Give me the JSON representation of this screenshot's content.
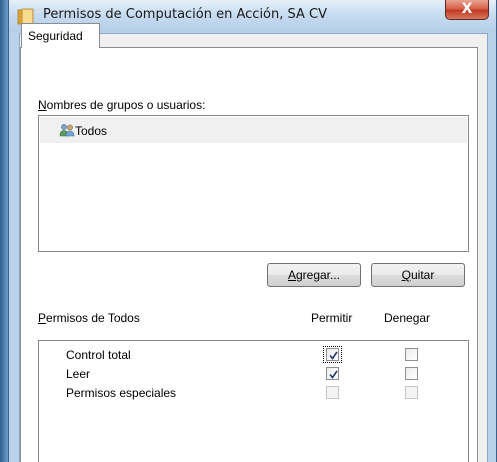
{
  "window": {
    "title": "Permisos de Computación en Acción, SA CV",
    "close_glyph": "X",
    "title_icon": "folder-icon"
  },
  "tabs": [
    {
      "label": "Seguridad",
      "selected": true
    }
  ],
  "groups": {
    "label_mnemonic": "N",
    "label_rest": "ombres de grupos o usuarios:",
    "users": [
      {
        "name": "Todos",
        "icon": "users-group-icon",
        "selected": true
      }
    ]
  },
  "buttons": {
    "add_mnemonic": "A",
    "add_rest": "gregar...",
    "remove_mnemonic": "Q",
    "remove_rest": "uitar"
  },
  "permissions": {
    "label_mnemonic": "P",
    "label_rest": "ermisos de Todos",
    "col_allow": "Permitir",
    "col_deny": "Denegar",
    "rows": [
      {
        "name": "Control total",
        "allow": true,
        "deny": false,
        "allow_disabled": false,
        "deny_disabled": false
      },
      {
        "name": "Leer",
        "allow": true,
        "deny": false,
        "allow_disabled": false,
        "deny_disabled": false
      },
      {
        "name": "Permisos especiales",
        "allow": false,
        "deny": false,
        "allow_disabled": true,
        "deny_disabled": true
      }
    ]
  },
  "colors": {
    "selection_bg": "#f0f0f0",
    "close_button": "#c13a22",
    "title_bar": "#c8dcf0"
  }
}
